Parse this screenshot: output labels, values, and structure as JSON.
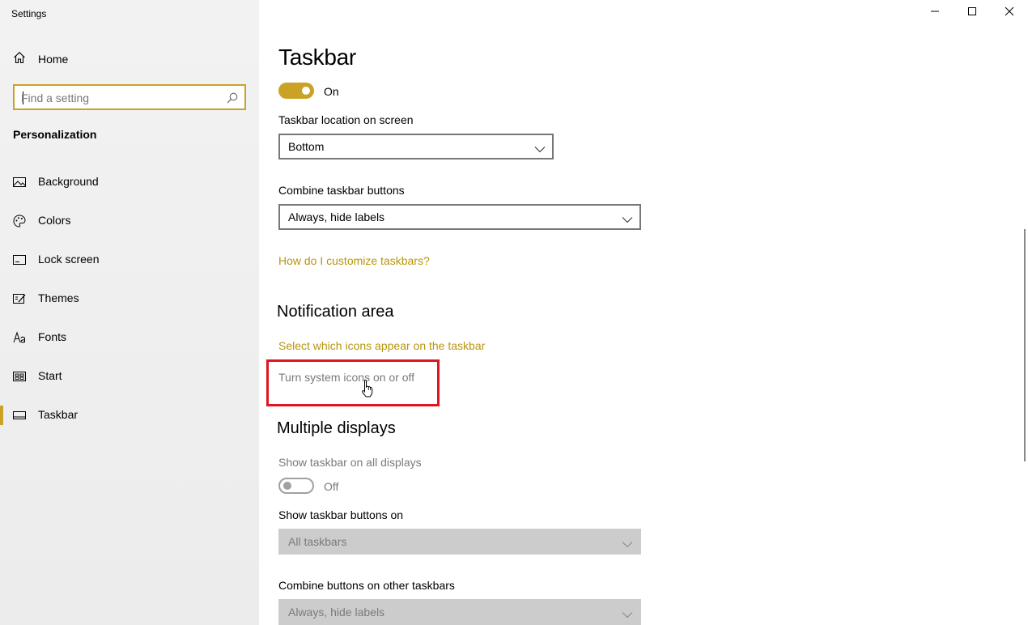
{
  "window": {
    "title": "Settings",
    "minimize_icon": "minimize-icon",
    "maximize_icon": "maximize-icon",
    "close_icon": "close-icon"
  },
  "sidebar": {
    "home_label": "Home",
    "search_placeholder": "Find a setting",
    "section_title": "Personalization",
    "items": [
      {
        "label": "Background",
        "icon": "picture-icon"
      },
      {
        "label": "Colors",
        "icon": "palette-icon"
      },
      {
        "label": "Lock screen",
        "icon": "lock-screen-icon"
      },
      {
        "label": "Themes",
        "icon": "themes-icon"
      },
      {
        "label": "Fonts",
        "icon": "fonts-icon"
      },
      {
        "label": "Start",
        "icon": "start-icon"
      },
      {
        "label": "Taskbar",
        "icon": "taskbar-icon",
        "selected": true
      }
    ]
  },
  "main": {
    "title": "Taskbar",
    "taskbar_toggle": {
      "state": "On",
      "on": true
    },
    "location": {
      "label": "Taskbar location on screen",
      "value": "Bottom"
    },
    "combine": {
      "label": "Combine taskbar buttons",
      "value": "Always, hide labels"
    },
    "customize_link": "How do I customize taskbars?",
    "notification_area": {
      "heading": "Notification area",
      "select_icons_link": "Select which icons appear on the taskbar",
      "system_icons_link": "Turn system icons on or off"
    },
    "multiple_displays": {
      "heading": "Multiple displays",
      "show_all_label": "Show taskbar on all displays",
      "show_all_state": "Off",
      "buttons_on_label": "Show taskbar buttons on",
      "buttons_on_value": "All taskbars",
      "combine_other_label": "Combine buttons on other taskbars",
      "combine_other_value": "Always, hide labels"
    }
  },
  "colors": {
    "accent": "#c9a227",
    "link": "#b8960c",
    "highlight_box": "#e0151f",
    "disabled_fill": "#cccccc"
  }
}
